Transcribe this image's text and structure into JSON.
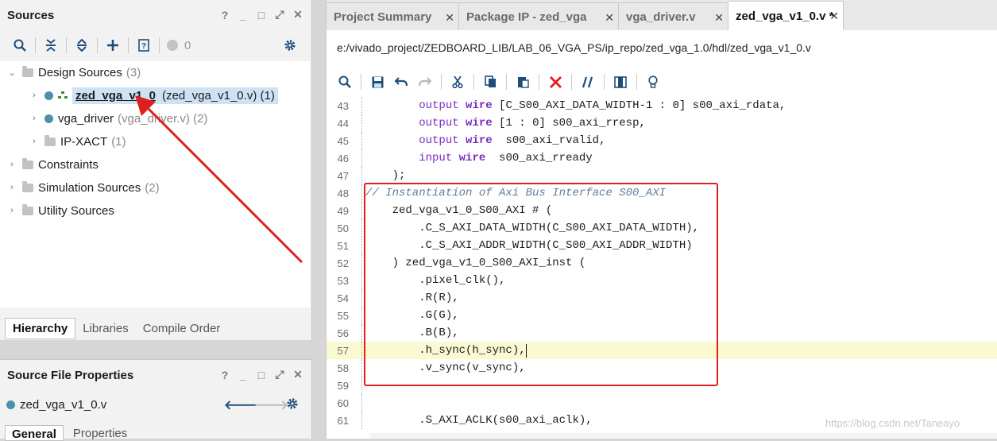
{
  "sources": {
    "title": "Sources",
    "window_controls": [
      "?",
      "_",
      "□",
      "⤢",
      "✕"
    ],
    "toolbar": {
      "error_count": "0"
    },
    "tree": [
      {
        "label": "Design Sources",
        "count": "(3)",
        "level": 0,
        "expanded": true
      },
      {
        "label": "zed_vga_v1_0",
        "detail": "(zed_vga_v1_0.v) (1)",
        "level": 1,
        "selected": true
      },
      {
        "label": "vga_driver",
        "detail": "(vga_driver.v) (2)",
        "level": 1
      },
      {
        "label": "IP-XACT",
        "detail": "(1)",
        "level": 1
      },
      {
        "label": "Constraints",
        "detail": "",
        "level": 0
      },
      {
        "label": "Simulation Sources",
        "detail": "(2)",
        "level": 0
      },
      {
        "label": "Utility Sources",
        "detail": "",
        "level": 0
      }
    ],
    "bottom_tabs": [
      "Hierarchy",
      "Libraries",
      "Compile Order"
    ]
  },
  "props": {
    "title": "Source File Properties",
    "window_controls": [
      "?",
      "_",
      "□",
      "⤢",
      "✕"
    ],
    "file": "zed_vga_v1_0.v",
    "tabs": [
      "General",
      "Properties"
    ]
  },
  "editor": {
    "tabs": [
      {
        "label": "Project Summary",
        "active": false
      },
      {
        "label": "Package IP - zed_vga",
        "active": false
      },
      {
        "label": "vga_driver.v",
        "active": false
      },
      {
        "label": "zed_vga_v1_0.v *",
        "active": true
      }
    ],
    "path": "e:/vivado_project/ZEDBOARD_LIB/LAB_06_VGA_PS/ip_repo/zed_vga_1.0/hdl/zed_vga_v1_0.v",
    "lines": [
      {
        "n": "43",
        "text": "        output wire [C_S00_AXI_DATA_WIDTH-1 : 0] s00_axi_rdata,"
      },
      {
        "n": "44",
        "text": "        output wire [1 : 0] s00_axi_rresp,"
      },
      {
        "n": "45",
        "text": "        output wire  s00_axi_rvalid,"
      },
      {
        "n": "46",
        "text": "        input wire  s00_axi_rready"
      },
      {
        "n": "47",
        "text": "    );"
      },
      {
        "n": "48",
        "text": "// Instantiation of Axi Bus Interface S00_AXI"
      },
      {
        "n": "49",
        "text": "    zed_vga_v1_0_S00_AXI # ("
      },
      {
        "n": "50",
        "text": "        .C_S_AXI_DATA_WIDTH(C_S00_AXI_DATA_WIDTH),"
      },
      {
        "n": "51",
        "text": "        .C_S_AXI_ADDR_WIDTH(C_S00_AXI_ADDR_WIDTH)"
      },
      {
        "n": "52",
        "text": "    ) zed_vga_v1_0_S00_AXI_inst ("
      },
      {
        "n": "53",
        "text": "        .pixel_clk(),"
      },
      {
        "n": "54",
        "text": "        .R(R),"
      },
      {
        "n": "55",
        "text": "        .G(G),"
      },
      {
        "n": "56",
        "text": "        .B(B),"
      },
      {
        "n": "57",
        "text": "        .h_sync(h_sync),"
      },
      {
        "n": "58",
        "text": "        .v_sync(v_sync),"
      },
      {
        "n": "59",
        "text": ""
      },
      {
        "n": "60",
        "text": ""
      },
      {
        "n": "61",
        "text": "        .S_AXI_ACLK(s00_axi_aclk),"
      }
    ],
    "watermark": "https://blog.csdn.net/Taneayo"
  },
  "colors": {
    "accent": "#1f4d7a",
    "annotation_red": "#e02020",
    "selection": "#cfe1f5",
    "keyword": "#7b2bc3"
  }
}
